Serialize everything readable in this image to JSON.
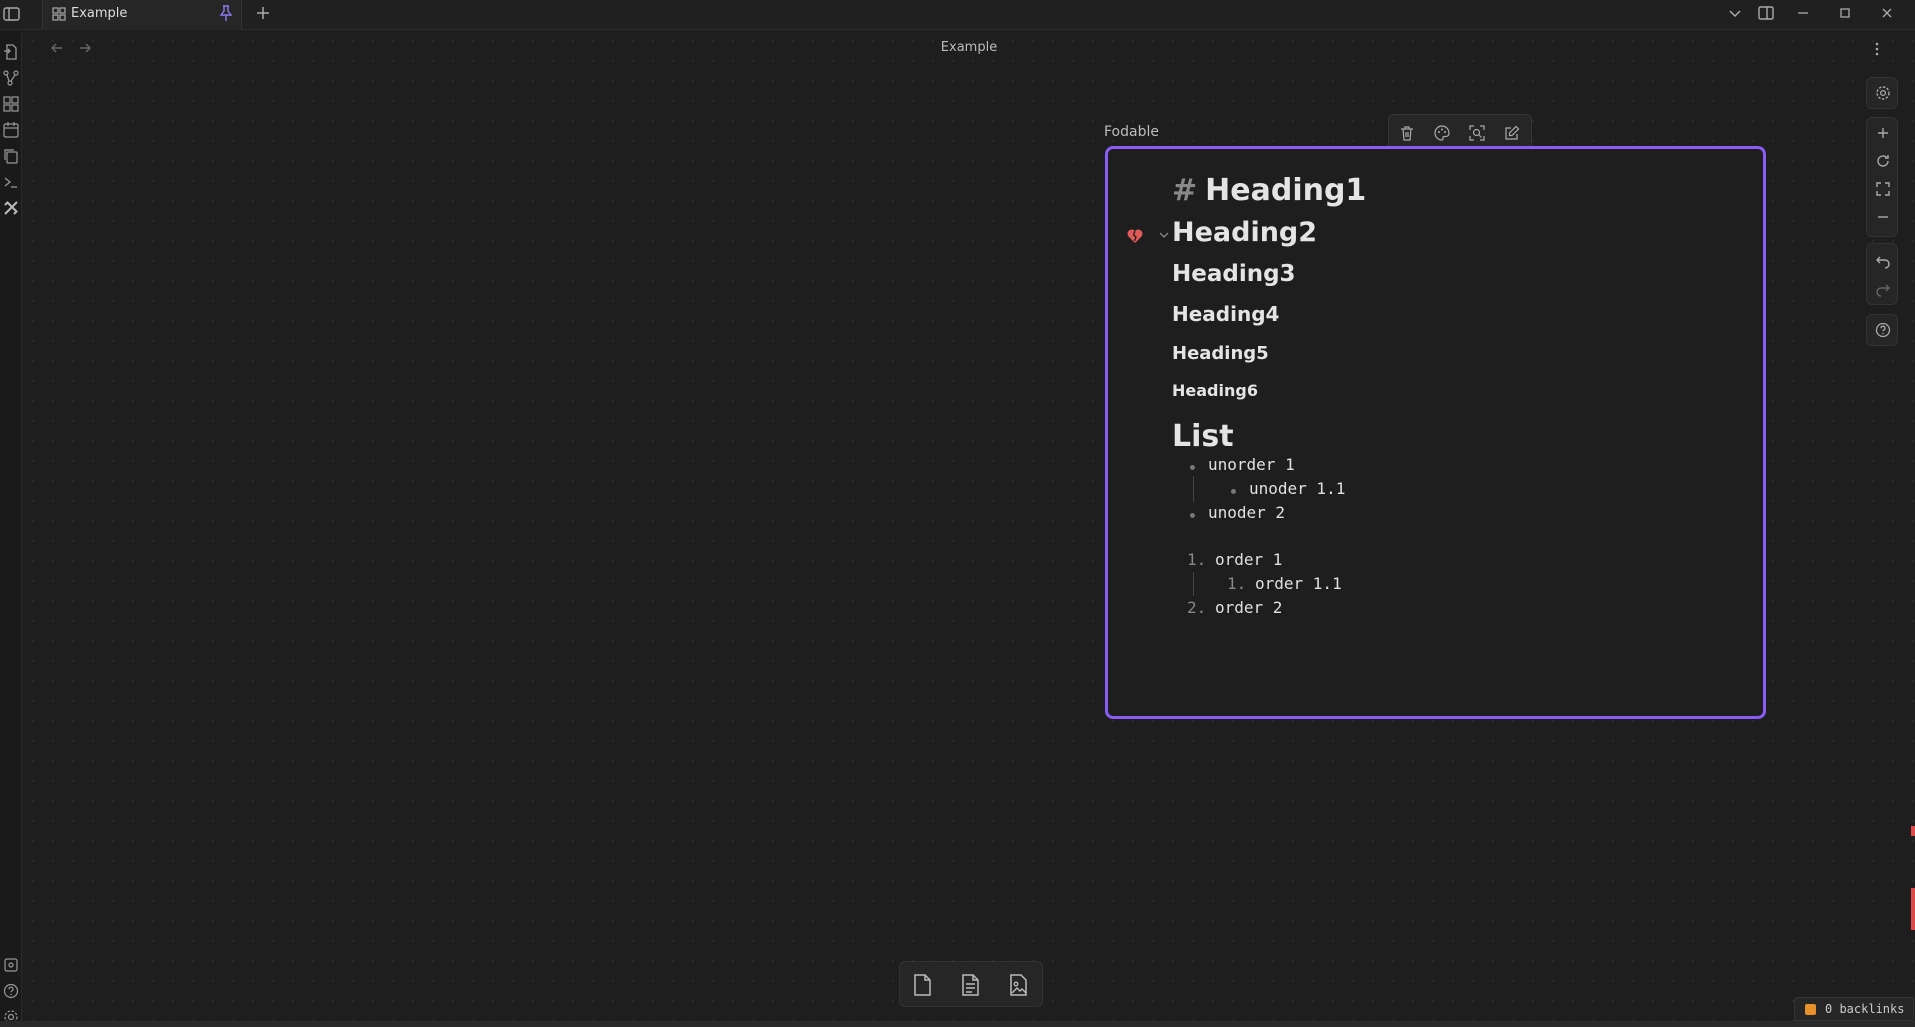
{
  "tab": {
    "label": "Example"
  },
  "view": {
    "title": "Example"
  },
  "node": {
    "label": "Fodable",
    "heading1_hash": "#",
    "heading1": "Heading1",
    "heading2": "Heading2",
    "heading3": "Heading3",
    "heading4": "Heading4",
    "heading5": "Heading5",
    "heading6": "Heading6",
    "list_heading": "List",
    "unordered": [
      "unorder 1",
      "unoder 1.1",
      "unoder 2"
    ],
    "ordered": [
      {
        "num": "1.",
        "text": "order 1"
      },
      {
        "num": "1.",
        "text": "order 1.1"
      },
      {
        "num": "2.",
        "text": "order 2"
      }
    ]
  },
  "status": {
    "backlinks": "0 backlinks"
  },
  "colors": {
    "accent": "#8a5cf5",
    "heart": "#e05a5a",
    "backlinks_square": "#e8902c"
  }
}
